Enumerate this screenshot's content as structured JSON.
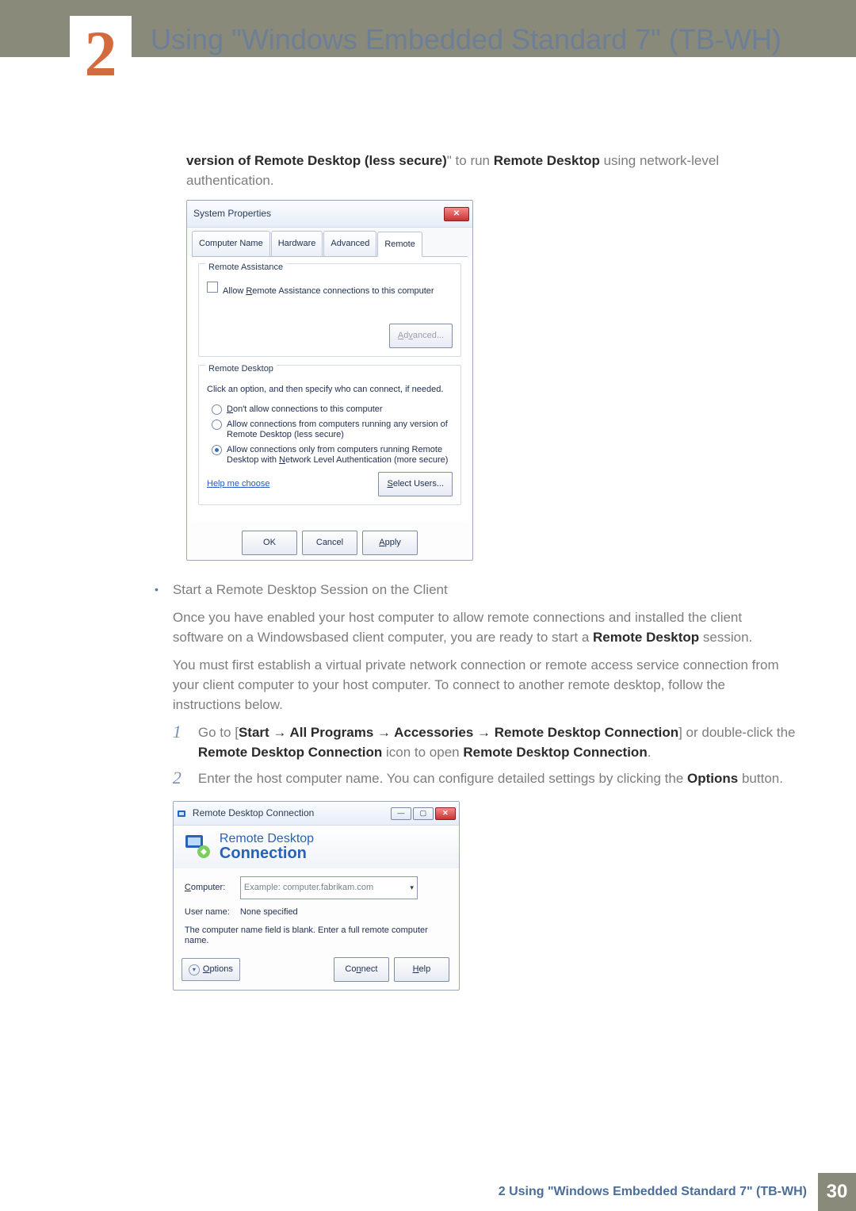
{
  "header": {
    "chapter_number": "2",
    "title": "Using \"Windows Embedded Standard 7\" (TB-WH)"
  },
  "intro": {
    "bold_fragment": "version of Remote Desktop (less secure)",
    "plain_tail": "\" to run ",
    "bold_fragment2": "Remote Desktop",
    "plain_tail2": " using network-level authentication."
  },
  "sysprops": {
    "title": "System Properties",
    "tabs": [
      "Computer Name",
      "Hardware",
      "Advanced",
      "Remote"
    ],
    "active_tab_index": 3,
    "ra_group": "Remote Assistance",
    "ra_checkbox": "Allow Remote Assistance connections to this computer",
    "advanced_btn": "Advanced...",
    "rd_group": "Remote Desktop",
    "rd_instr": "Click an option, and then specify who can connect, if needed.",
    "opt1": "Don't allow connections to this computer",
    "opt2": "Allow connections from computers running any version of Remote Desktop (less secure)",
    "opt3": "Allow connections only from computers running Remote Desktop with Network Level Authentication (more secure)",
    "help_link": "Help me choose",
    "select_users_btn": "Select Users...",
    "buttons": {
      "ok": "OK",
      "cancel": "Cancel",
      "apply": "Apply"
    }
  },
  "bullet": {
    "title": "Start a Remote Desktop Session on the Client",
    "p1_a": "Once you have enabled your host computer to allow remote connections and installed the client software on a Windowsbased client computer, you are ready to start a ",
    "p1_bold": "Remote Desktop",
    "p1_b": " session.",
    "p2": "You must first establish a virtual private network connection or remote access service connection from your client computer to your host computer. To connect to another remote desktop, follow the instructions below."
  },
  "steps": {
    "one": {
      "pre": "Go to [",
      "path": "Start → All Programs → Accessories → Remote Desktop Connection",
      "mid": "] or double-click the ",
      "b1": "Remote Desktop Connection",
      "mid2": " icon to open ",
      "b2": "Remote Desktop Connection",
      "end": "."
    },
    "two": {
      "text": "Enter the host computer name. You can configure detailed settings by clicking the ",
      "bold": "Options",
      "end": " button."
    }
  },
  "rdc": {
    "title": "Remote Desktop Connection",
    "banner_line1": "Remote Desktop",
    "banner_line2": "Connection",
    "computer_label": "Computer:",
    "computer_placeholder": "Example: computer.fabrikam.com",
    "username_label": "User name:",
    "username_value": "None specified",
    "note": "The computer name field is blank. Enter a full remote computer name.",
    "options_btn": "Options",
    "connect_btn": "Connect",
    "help_btn": "Help"
  },
  "footer": {
    "text": "2 Using \"Windows Embedded Standard 7\" (TB-WH)",
    "page": "30"
  }
}
